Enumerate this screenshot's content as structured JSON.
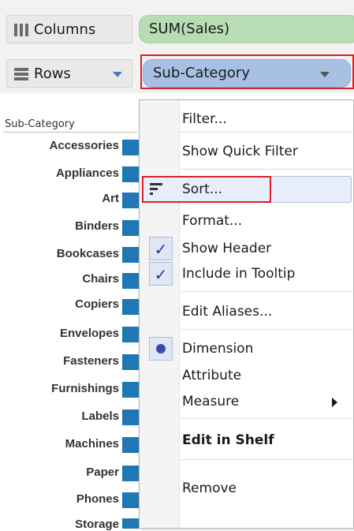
{
  "shelves": {
    "columns": {
      "label": "Columns",
      "pill": "SUM(Sales)"
    },
    "rows": {
      "label": "Rows",
      "pill": "Sub-Category"
    }
  },
  "view": {
    "axis_title": "Sub-Category",
    "categories": [
      "Accessories",
      "Appliances",
      "Art",
      "Binders",
      "Bookcases",
      "Chairs",
      "Copiers",
      "Envelopes",
      "Fasteners",
      "Furnishings",
      "Labels",
      "Machines",
      "Paper",
      "Phones",
      "Storage"
    ]
  },
  "menu": {
    "items": {
      "filter": "Filter...",
      "quick_filter": "Show Quick Filter",
      "sort": "Sort...",
      "format": "Format...",
      "show_header": "Show Header",
      "include_tooltip": "Include in Tooltip",
      "edit_aliases": "Edit Aliases...",
      "dimension": "Dimension",
      "attribute": "Attribute",
      "measure": "Measure",
      "edit_in_shelf": "Edit in Shelf",
      "remove": "Remove"
    },
    "checks": {
      "show_header": true,
      "include_tooltip": true
    },
    "selected_role": "dimension"
  },
  "colors": {
    "bar": "#1f77b4",
    "highlight_box": "#d8232a",
    "columns_pill": "#b8dcb3",
    "rows_pill": "#a8c0e4"
  }
}
